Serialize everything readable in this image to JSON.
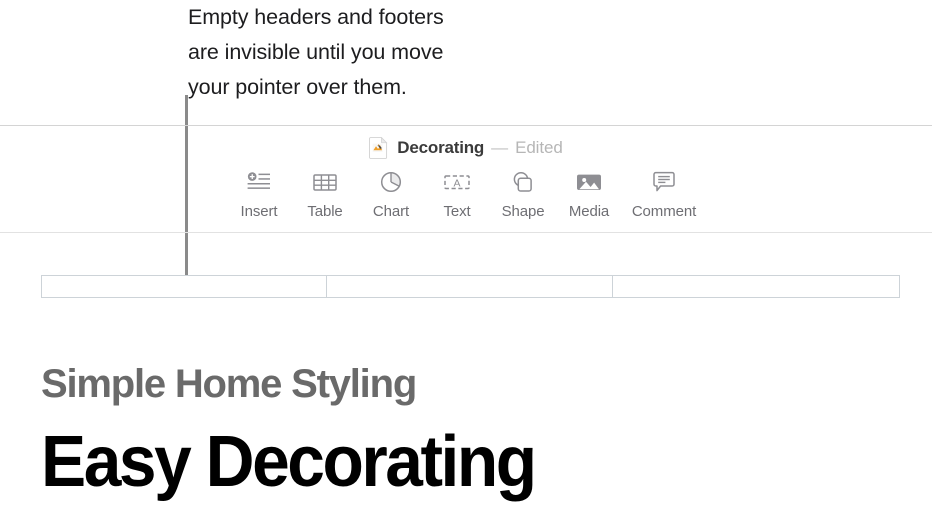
{
  "callout": {
    "text": "Empty headers and footers\nare invisible until you move\nyour pointer over them.",
    "leader_line": "vertical-leader-line"
  },
  "titlebar": {
    "document_icon": "pages-document-icon",
    "title": "Decorating",
    "separator": "—",
    "status": "Edited"
  },
  "toolbar": {
    "items": [
      {
        "label": "Insert",
        "icon": "insert-icon"
      },
      {
        "label": "Table",
        "icon": "table-icon"
      },
      {
        "label": "Chart",
        "icon": "pie-chart-icon"
      },
      {
        "label": "Text",
        "icon": "text-box-icon"
      },
      {
        "label": "Shape",
        "icon": "shape-icon"
      },
      {
        "label": "Media",
        "icon": "media-photo-icon"
      },
      {
        "label": "Comment",
        "icon": "comment-bubble-icon"
      }
    ]
  },
  "header_fields": {
    "left": "",
    "center": "",
    "right": ""
  },
  "document": {
    "subtitle": "Simple Home Styling",
    "heading": "Easy Decorating"
  },
  "colors": {
    "page_background": "#ffffff",
    "rule": "#dcdcdc",
    "toolbar_icon": "#8e8e93",
    "toolbar_label": "#6e6e73",
    "title_text": "#3b3b3b",
    "status_text": "#b6b6b6",
    "header_field_border": "#cdd3d8",
    "subtitle_text": "#6a6a6a",
    "heading_text": "#000000",
    "leader_line": "#8a8a8a",
    "doc_icon_accent": "#f0a02a"
  }
}
